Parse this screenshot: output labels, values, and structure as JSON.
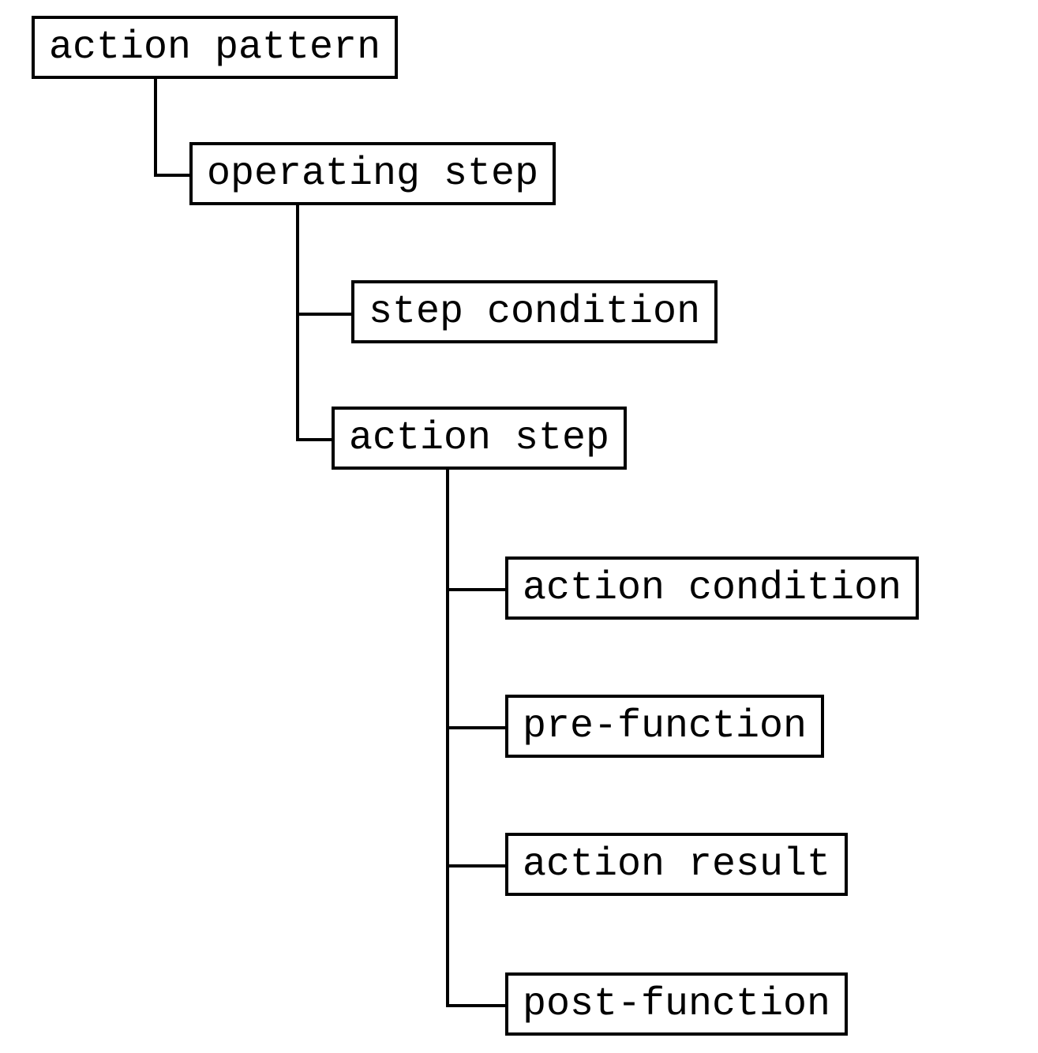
{
  "nodes": {
    "action_pattern": "action pattern",
    "operating_step": "operating step",
    "step_condition": "step condition",
    "action_step": "action step",
    "action_condition": "action condition",
    "pre_function": "pre-function",
    "action_result": "action result",
    "post_function": "post-function"
  },
  "chart_data": {
    "type": "tree",
    "title": "",
    "root": {
      "label": "action pattern",
      "children": [
        {
          "label": "operating step",
          "children": [
            {
              "label": "step condition",
              "children": []
            },
            {
              "label": "action step",
              "children": [
                {
                  "label": "action condition",
                  "children": []
                },
                {
                  "label": "pre-function",
                  "children": []
                },
                {
                  "label": "action result",
                  "children": []
                },
                {
                  "label": "post-function",
                  "children": []
                }
              ]
            }
          ]
        }
      ]
    }
  }
}
